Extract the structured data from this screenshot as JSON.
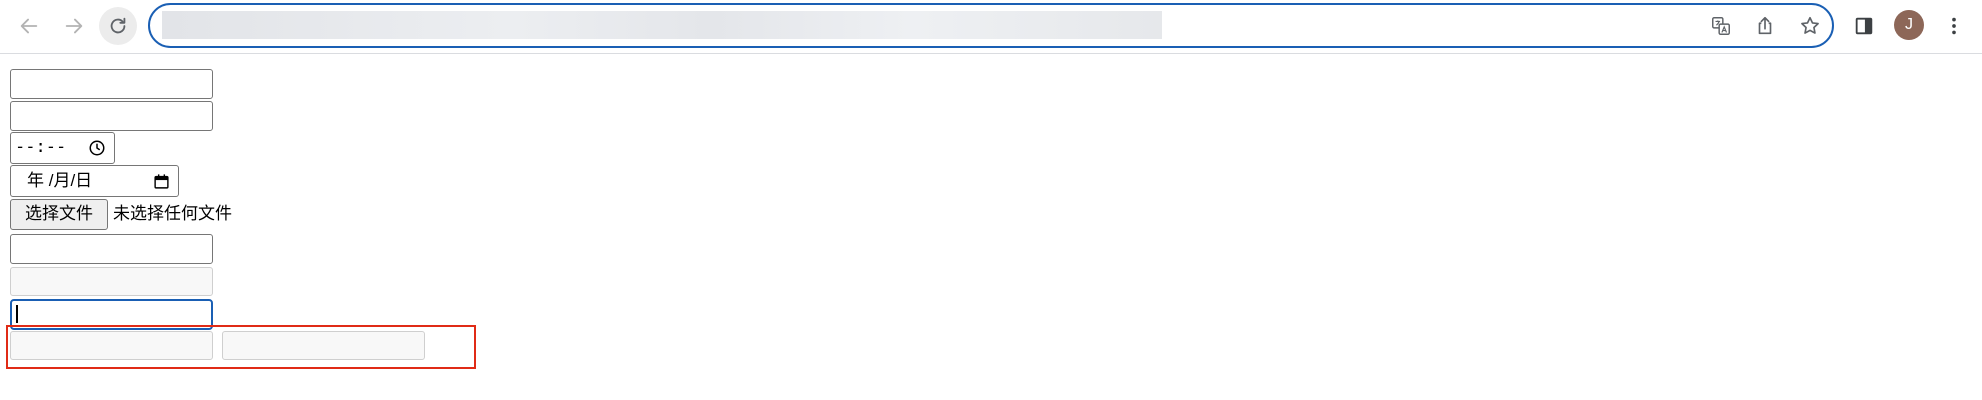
{
  "browser": {
    "nav": {
      "back_icon": "arrow-left-icon",
      "forward_icon": "arrow-right-icon",
      "reload_icon": "reload-icon"
    },
    "omnibox": {
      "url": "",
      "icons": [
        "translate-icon",
        "share-icon",
        "bookmark-star-icon"
      ]
    },
    "side_panel_icon": "side-panel-icon",
    "profile": {
      "initial": "J",
      "color": "#8d6758"
    },
    "menu_icon": "more-vert-icon",
    "focus_color": "#1a5fb4"
  },
  "form": {
    "text_input_1": {
      "value": ""
    },
    "text_input_2": {
      "value": ""
    },
    "time_input": {
      "value": "--:--",
      "icon": "clock-icon"
    },
    "date_input": {
      "value": "年 /月/日",
      "icon": "calendar-icon"
    },
    "file_input": {
      "button_label": "选择文件",
      "status": "未选择任何文件"
    },
    "text_input_3": {
      "value": ""
    },
    "readonly_input": {
      "value": ""
    },
    "focused_input": {
      "value": ""
    },
    "highlighted_inputs": [
      {
        "value": ""
      },
      {
        "value": ""
      }
    ],
    "highlight_color": "#e02b16"
  }
}
